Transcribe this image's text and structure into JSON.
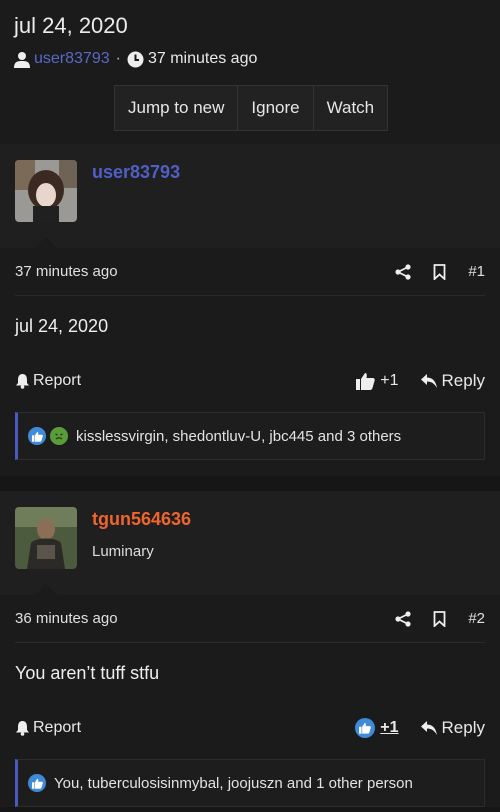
{
  "thread": {
    "title": "jul 24, 2020",
    "author": "user83793",
    "time": "37 minutes ago",
    "buttons": {
      "jump_to_new": "Jump to new",
      "ignore": "Ignore",
      "watch": "Watch"
    }
  },
  "posts": [
    {
      "username": "user83793",
      "username_color": "#4f5fc5",
      "user_title": "",
      "time": "37 minutes ago",
      "post_number": "#1",
      "content": "jul 24, 2020",
      "report_label": "Report",
      "reaction_count": "+1",
      "reply_label": "Reply",
      "reactions_text": "kisslessvirgin, shedontluv-U, jbc445 and 3 others",
      "reaction_icons": [
        "thumbs-up-reaction-icon",
        "sick-face-reaction-icon"
      ]
    },
    {
      "username": "tgun564636",
      "username_color": "#f0642e",
      "user_title": "Luminary",
      "time": "36 minutes ago",
      "post_number": "#2",
      "content": "You aren’t tuff stfu",
      "report_label": "Report",
      "reaction_count": "+1",
      "reply_label": "Reply",
      "reactions_text": "You, tuberculosisinmybal, joojuszn and 1 other person",
      "reaction_icons": [
        "thumbs-up-reaction-icon"
      ]
    }
  ],
  "colors": {
    "accent": "#4a5bbf",
    "background": "#161616",
    "panel": "#1f1f1f"
  }
}
